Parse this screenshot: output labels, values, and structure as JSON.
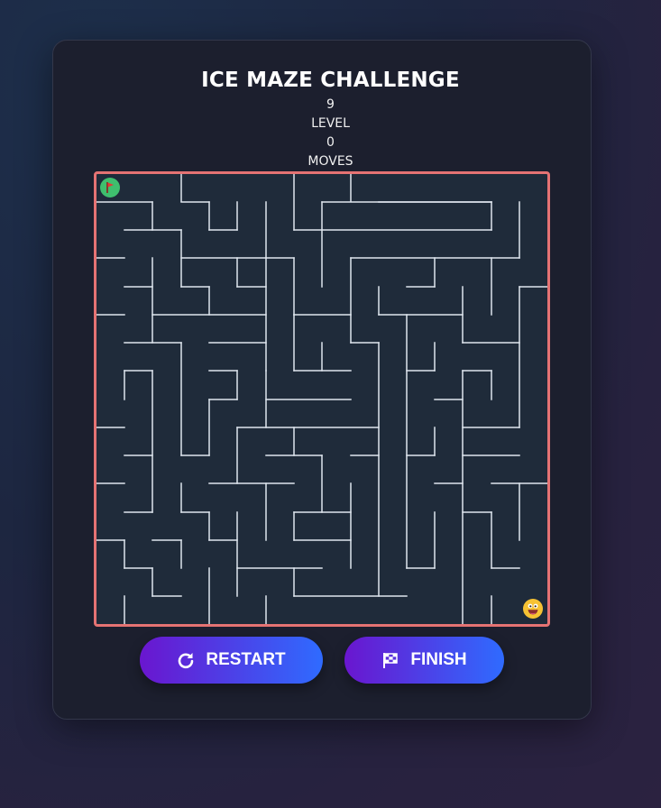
{
  "game": {
    "title": "ICE MAZE CHALLENGE",
    "level_value": "9",
    "level_label": "LEVEL",
    "moves_value": "0",
    "moves_label": "MOVES"
  },
  "buttons": {
    "restart_label": "RESTART",
    "finish_label": "FINISH"
  },
  "icons": {
    "start": "flag-icon",
    "player": "grinning-face-icon",
    "restart": "restart-icon",
    "finish": "checkered-flag-icon"
  },
  "colors": {
    "maze_border": "#e57373",
    "maze_background": "#1f2b3a",
    "wall": "#dfe6ee",
    "button_gradient_start": "#6a16cf",
    "button_gradient_end": "#2f6bff",
    "start_marker": "#3fbf6e",
    "player": "#f6c233"
  }
}
